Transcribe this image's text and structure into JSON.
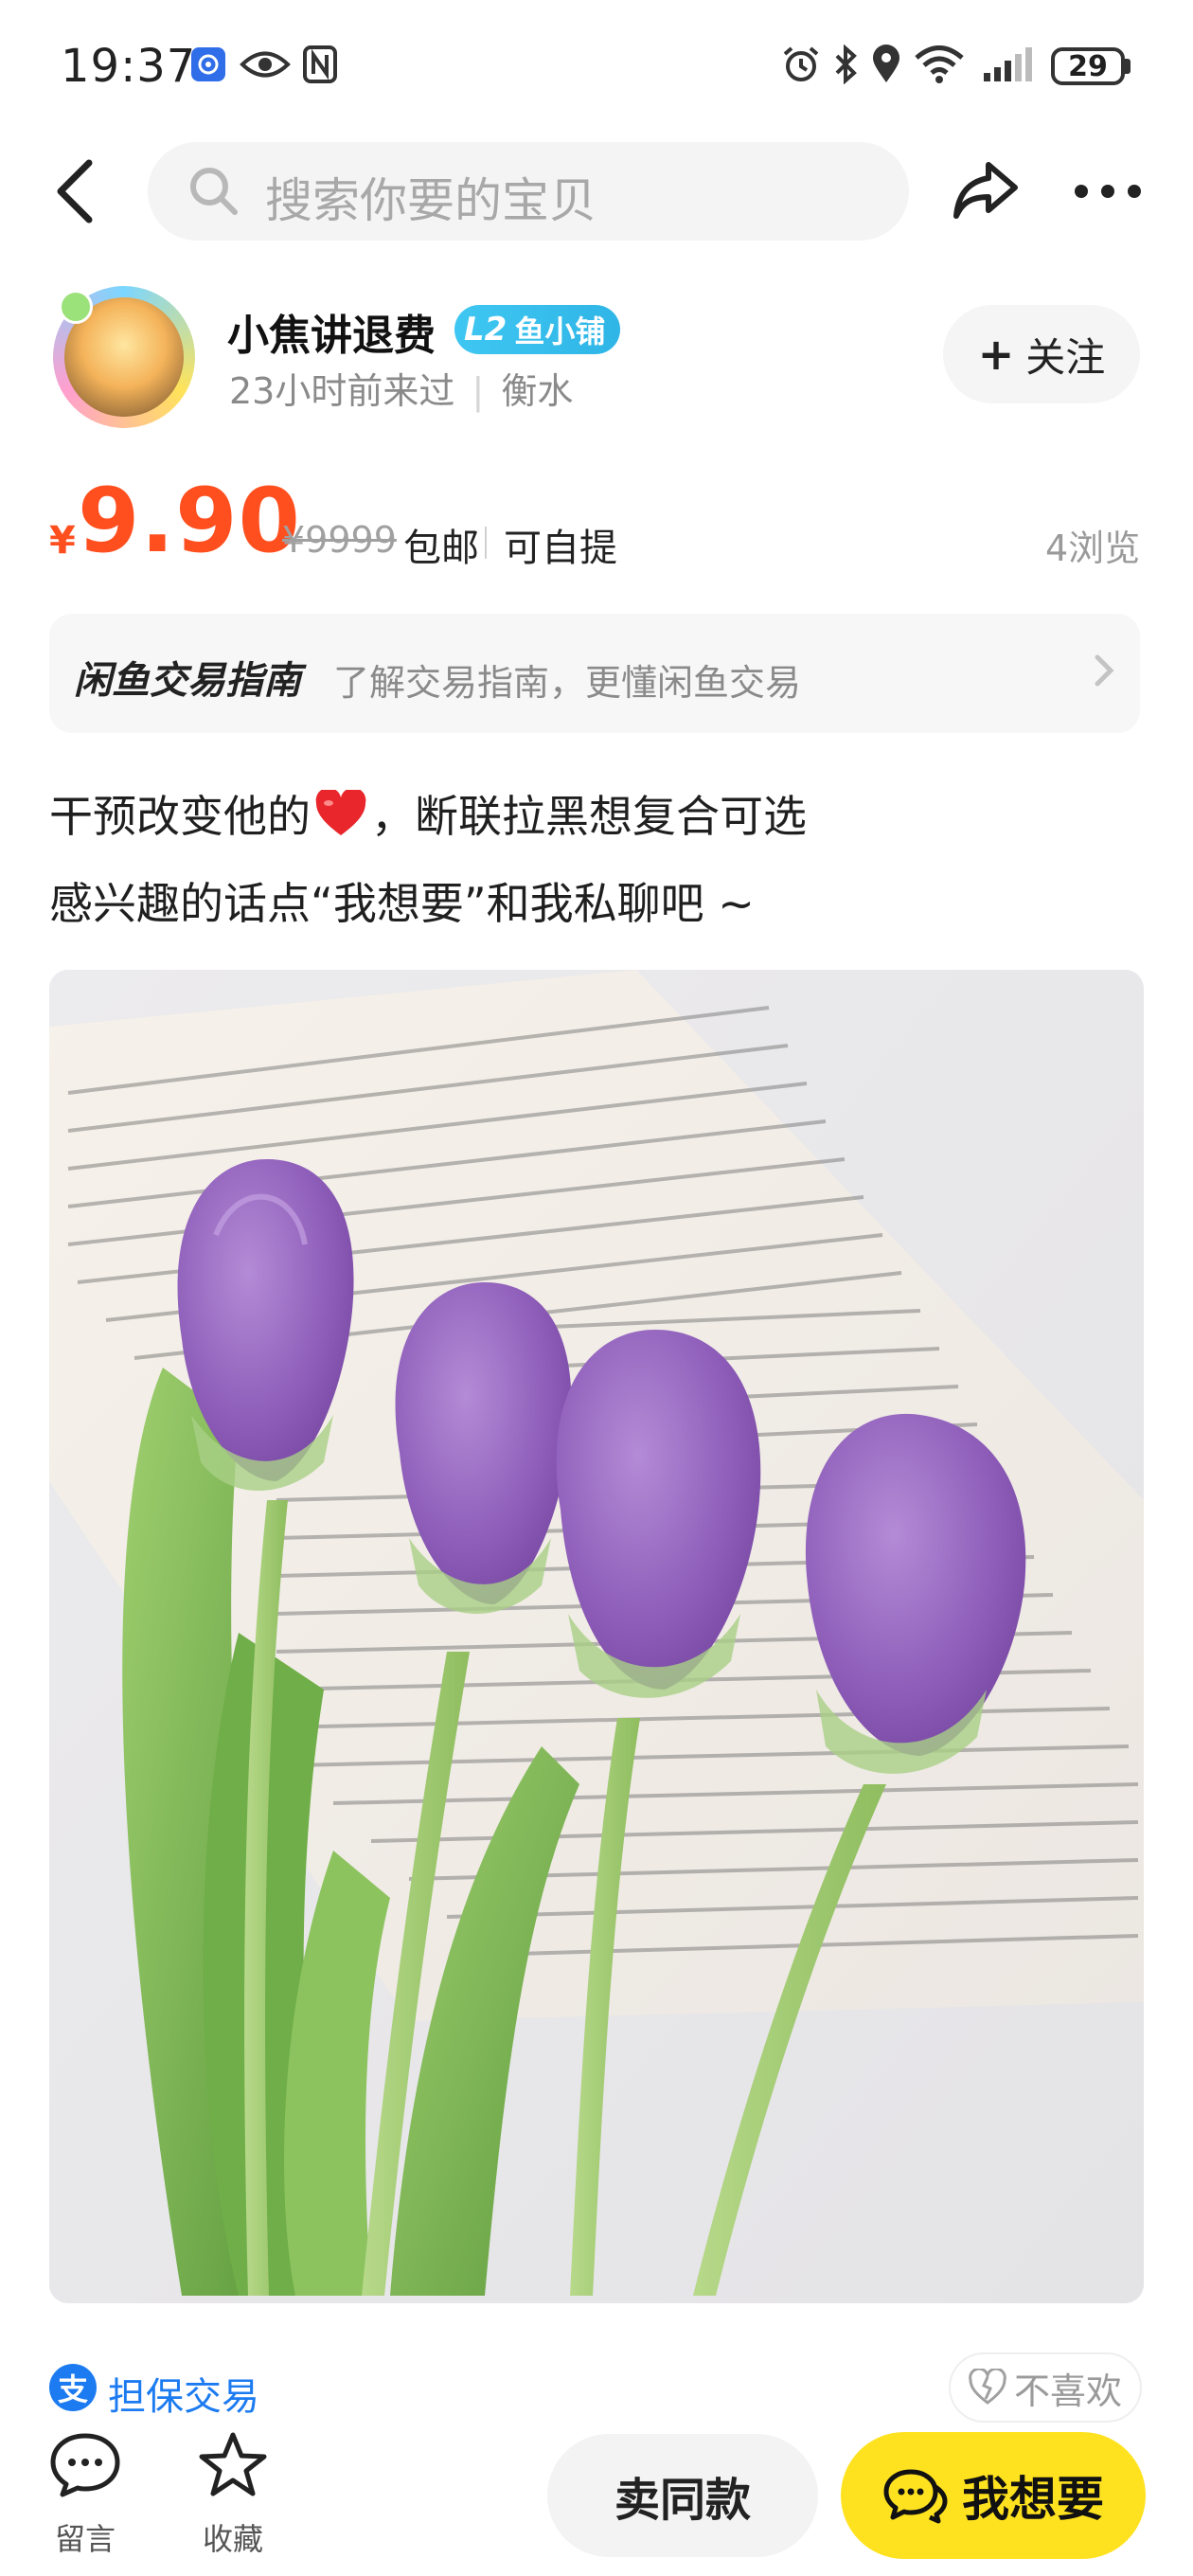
{
  "status_bar": {
    "time": "19:37",
    "battery": "29",
    "icons": [
      "app-notification-icon",
      "eye-icon",
      "nfc-icon",
      "alarm-icon",
      "bluetooth-icon",
      "location-icon",
      "wifi-icon",
      "signal-icon",
      "battery-icon"
    ]
  },
  "top_nav": {
    "back_icon": "back-arrow-icon",
    "search_placeholder": "搜索你要的宝贝",
    "share_icon": "share-icon",
    "more_icon": "more-icon"
  },
  "seller": {
    "name": "小焦讲退费",
    "badge_level": "L2",
    "badge_text": "鱼小铺",
    "last_seen": "23小时前来过",
    "location": "衡水",
    "follow_label": "关注"
  },
  "price": {
    "currency": "¥",
    "value": "9.90",
    "original": "¥9999",
    "tags": [
      "包邮",
      "可自提"
    ],
    "views": "4浏览"
  },
  "guide": {
    "title": "闲鱼交易指南",
    "description": "了解交易指南，更懂闲鱼交易"
  },
  "description": {
    "line1_a": "干预改变他的",
    "line1_b": "，断联拉黑想复合可选",
    "line2": "感兴趣的话点“我想要”和我私聊吧 ~"
  },
  "escrow": {
    "icon_char": "支",
    "label": "担保交易"
  },
  "dislike_label": "不喜欢",
  "bottom_bar": {
    "comment_label": "留言",
    "favorite_label": "收藏",
    "same_item_label": "卖同款",
    "want_label": "我想要"
  },
  "colors": {
    "price": "#ff4f1f",
    "badge": "#2fb5e6",
    "escrow": "#1c7bf0",
    "want_button": "#ffe21f"
  }
}
